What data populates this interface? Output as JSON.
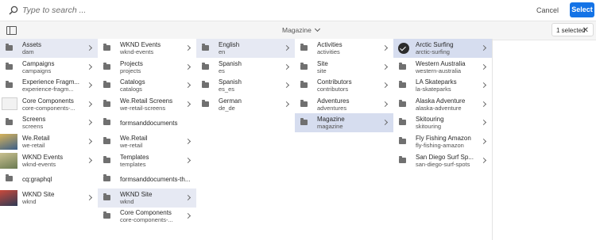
{
  "search": {
    "placeholder": "Type to search ..."
  },
  "header": {
    "cancel_label": "Cancel",
    "select_label": "Select"
  },
  "toolbar": {
    "breadcrumb": "Magazine",
    "selection_count": "1 selected"
  },
  "colors": {
    "accent": "#1473e6",
    "selected_row": "#d6ddef"
  },
  "columns": [
    {
      "name": "root",
      "items": [
        {
          "title": "Assets",
          "sub": "dam",
          "icon": "folder-icon",
          "chevron": true,
          "state": "sel"
        },
        {
          "title": "Campaigns",
          "sub": "campaigns",
          "icon": "folder-icon",
          "chevron": true
        },
        {
          "title": "Experience Fragm...",
          "sub": "experience-fragm...",
          "icon": "folder-icon",
          "chevron": true
        },
        {
          "title": "Core Components",
          "sub": "core-components-...",
          "icon": "page-thumbnail-icon",
          "chevron": true
        },
        {
          "title": "Screens",
          "sub": "screens",
          "icon": "folder-icon",
          "chevron": true
        },
        {
          "title": "We.Retail",
          "sub": "we-retail",
          "icon": "photo-thumbnail-icon",
          "chevron": true
        },
        {
          "title": "WKND Events",
          "sub": "wknd-events",
          "icon": "photo-thumbnail-icon",
          "chevron": true
        },
        {
          "title": "cq:graphql",
          "sub": "",
          "icon": "folder-icon",
          "chevron": false
        },
        {
          "title": "WKND Site",
          "sub": "wknd",
          "icon": "photo-thumbnail-icon",
          "chevron": true
        }
      ]
    },
    {
      "name": "assets",
      "items": [
        {
          "title": "WKND Events",
          "sub": "wknd-events",
          "icon": "folder-icon",
          "chevron": true
        },
        {
          "title": "Projects",
          "sub": "projects",
          "icon": "folder-icon",
          "chevron": true
        },
        {
          "title": "Catalogs",
          "sub": "catalogs",
          "icon": "folder-icon",
          "chevron": true
        },
        {
          "title": "We.Retail Screens",
          "sub": "we-retail-screens",
          "icon": "folder-icon",
          "chevron": true
        },
        {
          "title": "formsanddocuments",
          "sub": "",
          "icon": "folder-icon",
          "chevron": false
        },
        {
          "title": "We.Retail",
          "sub": "we-retail",
          "icon": "folder-icon",
          "chevron": true
        },
        {
          "title": "Templates",
          "sub": "templates",
          "icon": "folder-icon",
          "chevron": true
        },
        {
          "title": "formsanddocuments-th...",
          "sub": "",
          "icon": "folder-icon",
          "chevron": false
        },
        {
          "title": "WKND Site",
          "sub": "wknd",
          "icon": "folder-icon",
          "chevron": true,
          "state": "sel"
        },
        {
          "title": "Core Components",
          "sub": "core-components-...",
          "icon": "folder-icon",
          "chevron": true
        }
      ]
    },
    {
      "name": "languages",
      "items": [
        {
          "title": "English",
          "sub": "en",
          "icon": "folder-icon",
          "chevron": true,
          "state": "sel"
        },
        {
          "title": "Spanish",
          "sub": "es",
          "icon": "folder-icon",
          "chevron": true
        },
        {
          "title": "Spanish",
          "sub": "es_es",
          "icon": "folder-icon",
          "chevron": true
        },
        {
          "title": "German",
          "sub": "de_de",
          "icon": "folder-icon",
          "chevron": true
        }
      ]
    },
    {
      "name": "english",
      "items": [
        {
          "title": "Activities",
          "sub": "activities",
          "icon": "folder-icon",
          "chevron": true
        },
        {
          "title": "Site",
          "sub": "site",
          "icon": "folder-icon",
          "chevron": true
        },
        {
          "title": "Contributors",
          "sub": "contributors",
          "icon": "folder-icon",
          "chevron": true
        },
        {
          "title": "Adventures",
          "sub": "adventures",
          "icon": "folder-icon",
          "chevron": true
        },
        {
          "title": "Magazine",
          "sub": "magazine",
          "icon": "folder-icon",
          "chevron": true,
          "state": "active"
        }
      ]
    },
    {
      "name": "magazine",
      "items": [
        {
          "title": "Arctic Surfing",
          "sub": "arctic-surfing",
          "icon": "checkmark-icon",
          "chevron": true,
          "state": "active"
        },
        {
          "title": "Western Australia",
          "sub": "western-australia",
          "icon": "folder-icon",
          "chevron": true
        },
        {
          "title": "LA Skateparks",
          "sub": "la-skateparks",
          "icon": "folder-icon",
          "chevron": true
        },
        {
          "title": "Alaska Adventure",
          "sub": "alaska-adventure",
          "icon": "folder-icon",
          "chevron": true
        },
        {
          "title": "Skitouring",
          "sub": "skitouring",
          "icon": "folder-icon",
          "chevron": true
        },
        {
          "title": "Fly Fishing Amazon",
          "sub": "fly-fishing-amazon",
          "icon": "folder-icon",
          "chevron": true
        },
        {
          "title": "San Diego Surf Sp...",
          "sub": "san-diego-surf-spots",
          "icon": "folder-icon",
          "chevron": true
        }
      ]
    }
  ]
}
